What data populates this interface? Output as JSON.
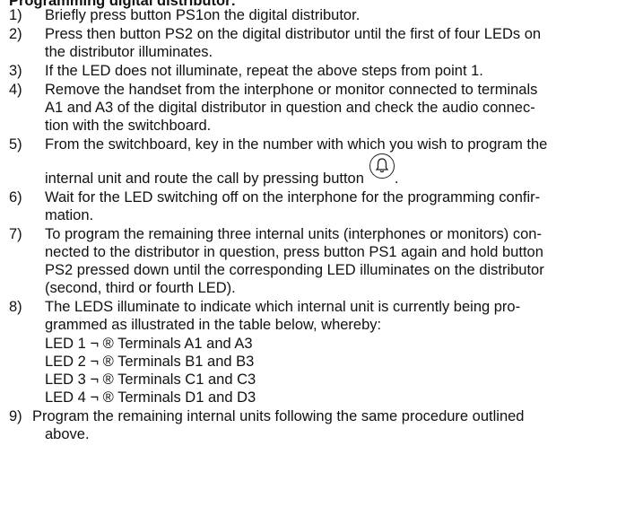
{
  "heading": "Programming digital distributor:",
  "steps": [
    {
      "num": "1)",
      "lines": [
        "Briefly press button PS1on the digital distributor."
      ]
    },
    {
      "num": "2)",
      "lines": [
        "Press then button PS2 on the digital distributor until the first of four LEDs on",
        "the distributor illuminates."
      ]
    },
    {
      "num": "3)",
      "lines": [
        "If the LED does not illuminate, repeat the above steps from point 1."
      ]
    },
    {
      "num": "4)",
      "lines": [
        "Remove the handset from the interphone or monitor connected to terminals",
        "A1 and A3 of the digital distributor in question and check the audio connec-",
        "tion with the switchboard."
      ]
    },
    {
      "num": "5)",
      "lines": [
        "From the switchboard, key in the number with which you wish to program the",
        "internal unit and route the call by pressing button",
        "."
      ]
    },
    {
      "num": "6)",
      "lines": [
        "Wait for the LED switching off on the interphone for the programming confir-",
        "mation."
      ]
    },
    {
      "num": "7)",
      "lines": [
        "To program the remaining three internal units (interphones or monitors) con-",
        "nected to the distributor in question, press button PS1 again and hold button",
        "PS2 pressed down until the corresponding LED illuminates on the distributor",
        "(second, third or fourth LED)."
      ]
    },
    {
      "num": "8)",
      "lines": [
        "The LEDS illuminate to indicate which internal unit is currently being pro-",
        "grammed as illustrated in the table below, whereby:"
      ]
    },
    {
      "num": "9)",
      "lines": [
        "Program the remaining internal units following the same procedure outlined",
        "above."
      ]
    }
  ],
  "led_map": [
    "LED 1 ¬ ® Terminals A1 and A3",
    "LED 2 ¬ ® Terminals B1 and B3",
    "LED 3 ¬ ® Terminals C1 and C3",
    "LED 4 ¬ ® Terminals D1 and D3"
  ],
  "icons": {
    "call_button": "bell-icon"
  }
}
